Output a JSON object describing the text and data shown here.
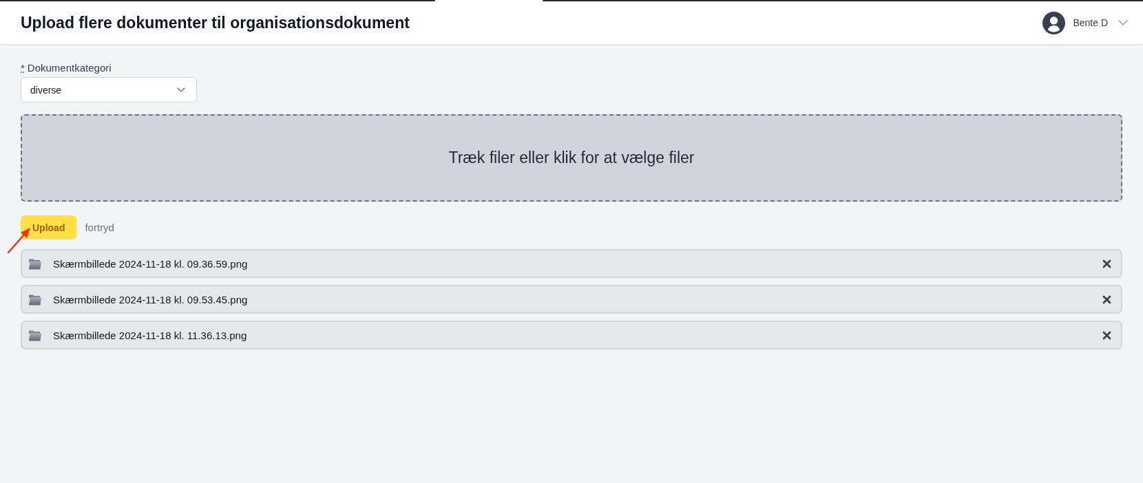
{
  "header": {
    "title": "Upload flere dokumenter til organisationsdokument",
    "user": {
      "name": "Bente D"
    }
  },
  "category": {
    "required_mark": "*",
    "label": "Dokumentkategori",
    "value": "diverse"
  },
  "dropzone": {
    "text": "Træk filer eller klik for at vælge filer"
  },
  "actions": [
    {
      "kind": "primary",
      "label": "Upload"
    },
    {
      "kind": "link",
      "label": "fortryd"
    }
  ],
  "files": [
    {
      "name": "Skærmbillede 2024-11-18 kl. 09.36.59.png"
    },
    {
      "name": "Skærmbillede 2024-11-18 kl. 09.53.45.png"
    },
    {
      "name": "Skærmbillede 2024-11-18 kl. 11.36.13.png"
    }
  ]
}
